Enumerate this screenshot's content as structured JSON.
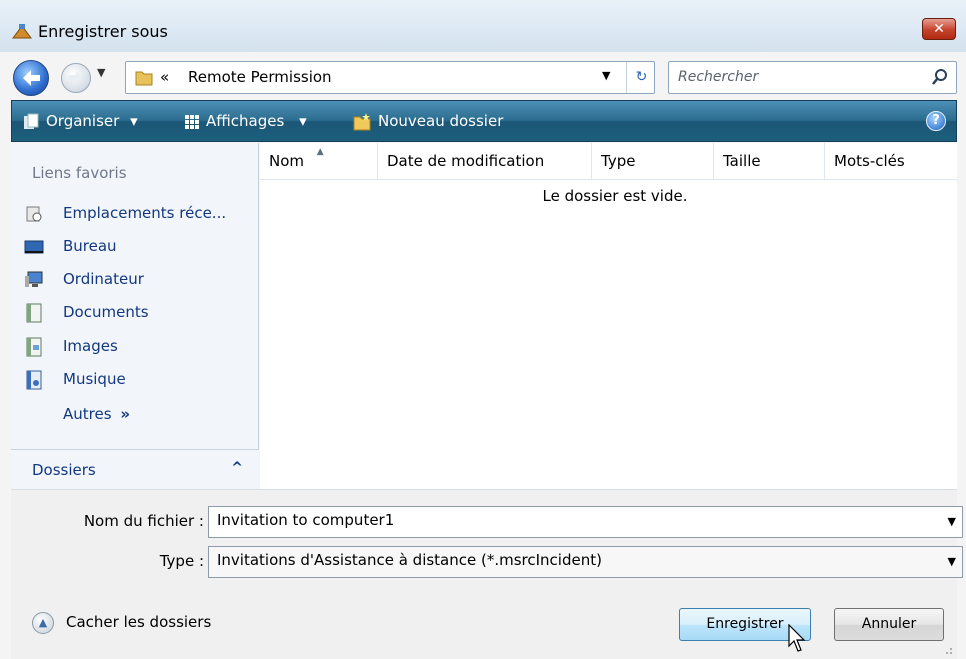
{
  "window": {
    "title": "Enregistrer sous",
    "close_glyph": "✕"
  },
  "address": {
    "separator": "«",
    "path": "Remote Permission",
    "dropdown_glyph": "▼",
    "refresh_glyph": "↻"
  },
  "search": {
    "placeholder": "Rechercher"
  },
  "toolbar": {
    "organize": "Organiser",
    "views": "Affichages",
    "new_folder": "Nouveau dossier",
    "help": "?",
    "caret": "▾"
  },
  "sidebar": {
    "heading": "Liens favoris",
    "items": [
      {
        "label": "Emplacements réce...",
        "icon": "recent-places-icon"
      },
      {
        "label": "Bureau",
        "icon": "desktop-icon"
      },
      {
        "label": "Ordinateur",
        "icon": "computer-icon"
      },
      {
        "label": "Documents",
        "icon": "documents-icon"
      },
      {
        "label": "Images",
        "icon": "pictures-icon"
      },
      {
        "label": "Musique",
        "icon": "music-icon"
      }
    ],
    "more": "Autres",
    "more_glyph": "»",
    "folders": "Dossiers",
    "folders_chevron": "^"
  },
  "file_list": {
    "columns": [
      "Nom",
      "Date de modification",
      "Type",
      "Taille",
      "Mots-clés"
    ],
    "empty_message": "Le dossier est vide.",
    "sort_glyph": "▲"
  },
  "form": {
    "filename_label": "Nom du fichier :",
    "filename_value": "Invitation to computer1",
    "type_label": "Type :",
    "type_value": "Invitations d'Assistance à distance (*.msrcIncident)"
  },
  "footer": {
    "hide_folders": "Cacher les dossiers",
    "save": "Enregistrer",
    "cancel": "Annuler"
  },
  "colors": {
    "toolbar": "#2c6d8f",
    "link": "#13387f",
    "close": "#c4422c"
  }
}
